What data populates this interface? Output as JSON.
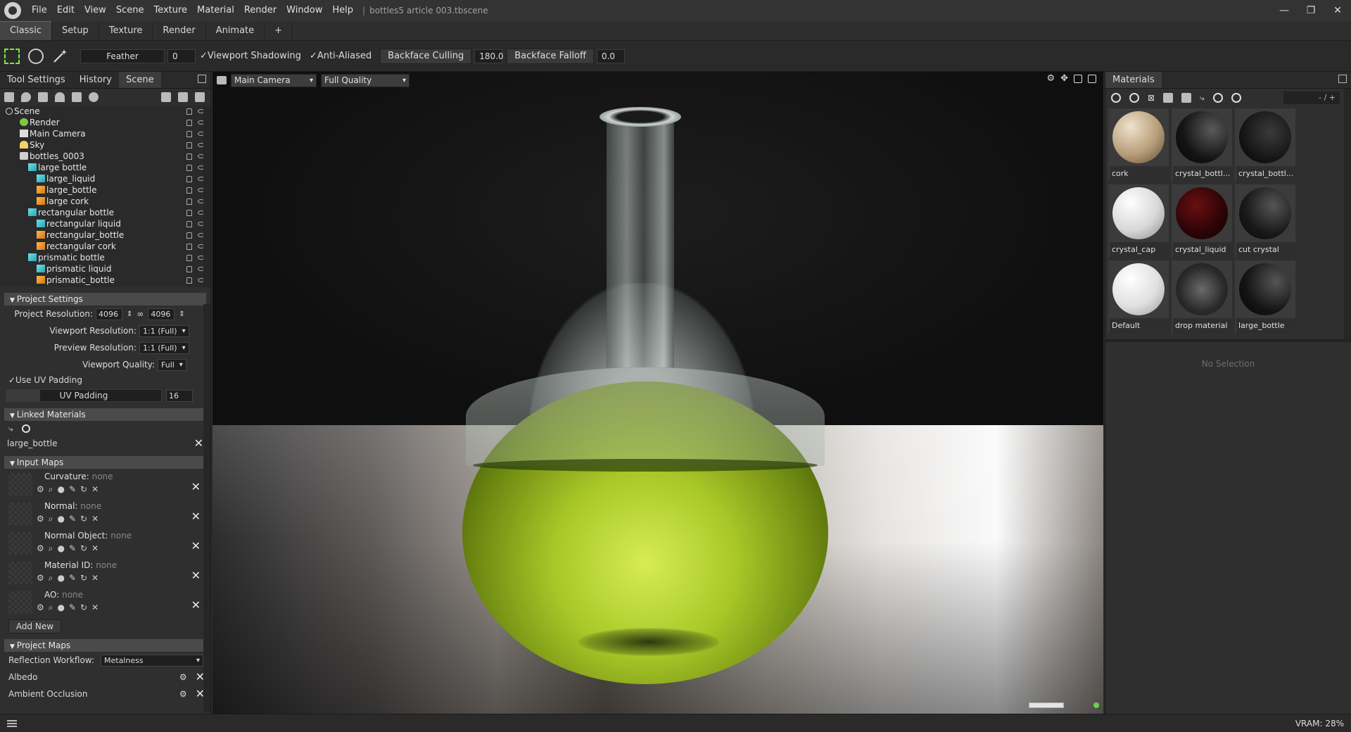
{
  "titlebar": {
    "menu": [
      "File",
      "Edit",
      "View",
      "Scene",
      "Texture",
      "Material",
      "Render",
      "Window",
      "Help"
    ],
    "separator": "|",
    "document_title": "bottles5 article 003.tbscene",
    "minimize": "—",
    "restore": "❐",
    "close": "✕"
  },
  "workspace_tabs": [
    "Classic",
    "Setup",
    "Texture",
    "Render",
    "Animate",
    "+"
  ],
  "toolbar": {
    "feather_label": "Feather",
    "feather_value": "0",
    "viewport_shadowing": "✓Viewport Shadowing",
    "anti_aliased": "✓Anti-Aliased",
    "backface_culling": "Backface Culling",
    "backface_culling_value": "180.0",
    "backface_falloff": "Backface Falloff",
    "backface_falloff_value": "0.0"
  },
  "left_tabs": [
    "Tool Settings",
    "History",
    "Scene"
  ],
  "scene_tree": [
    {
      "label": "Scene",
      "icon": "scene"
    },
    {
      "label": "Render",
      "icon": "render"
    },
    {
      "label": "Main Camera",
      "icon": "cam"
    },
    {
      "label": "Sky",
      "icon": "sky"
    },
    {
      "label": "bottles_0003",
      "icon": "folder"
    },
    {
      "label": "large bottle",
      "icon": "cube"
    },
    {
      "label": "large_liquid",
      "icon": "cube"
    },
    {
      "label": "large_bottle",
      "icon": "cube-orange"
    },
    {
      "label": "large cork",
      "icon": "cube-orange"
    },
    {
      "label": "rectangular bottle",
      "icon": "cube"
    },
    {
      "label": "rectangular liquid",
      "icon": "cube"
    },
    {
      "label": "rectangular_bottle",
      "icon": "cube-orange"
    },
    {
      "label": "rectangular cork",
      "icon": "cube-orange"
    },
    {
      "label": "prismatic bottle",
      "icon": "cube"
    },
    {
      "label": "prismatic liquid",
      "icon": "cube"
    },
    {
      "label": "prismatic_bottle",
      "icon": "cube-orange"
    }
  ],
  "project_settings": {
    "header": "Project Settings",
    "project_resolution_label": "Project Resolution:",
    "res_w": "4096",
    "res_h": "4096",
    "viewport_resolution_label": "Viewport Resolution:",
    "viewport_resolution": "1:1 (Full)",
    "preview_resolution_label": "Preview Resolution:",
    "preview_resolution": "1:1 (Full)",
    "viewport_quality_label": "Viewport Quality:",
    "viewport_quality": "Full",
    "use_uv_padding": "✓Use UV Padding",
    "uv_padding_label": "UV Padding",
    "uv_padding_value": "16"
  },
  "linked_materials": {
    "header": "Linked Materials",
    "item": "large_bottle"
  },
  "input_maps": {
    "header": "Input Maps",
    "maps": [
      {
        "name": "Curvature:",
        "value": "none"
      },
      {
        "name": "Normal:",
        "value": "none"
      },
      {
        "name": "Normal Object:",
        "value": "none"
      },
      {
        "name": "Material ID:",
        "value": "none"
      },
      {
        "name": "AO:",
        "value": "none"
      }
    ],
    "add_new": "Add New"
  },
  "project_maps": {
    "header": "Project Maps",
    "reflection_label": "Reflection Workflow:",
    "reflection_value": "Metalness",
    "items": [
      "Albedo",
      "Ambient Occlusion"
    ]
  },
  "viewport": {
    "camera": "Main Camera",
    "quality": "Full Quality"
  },
  "materials_panel": {
    "title": "Materials",
    "page": "- / +",
    "items": [
      {
        "label": "cork",
        "swatch": "cork"
      },
      {
        "label": "crystal_bottl...",
        "swatch": "dark-glass"
      },
      {
        "label": "crystal_bottl...",
        "swatch": "dark-sparkle"
      },
      {
        "label": "crystal_cap",
        "swatch": "white"
      },
      {
        "label": "crystal_liquid",
        "swatch": "dark-red"
      },
      {
        "label": "cut crystal",
        "swatch": "dark-sparkle"
      },
      {
        "label": "Default",
        "swatch": "white"
      },
      {
        "label": "drop material",
        "swatch": "droplets"
      },
      {
        "label": "large_bottle",
        "swatch": "dark-glass"
      }
    ],
    "no_selection": "No Selection"
  },
  "statusbar": {
    "vram": "VRAM: 28%"
  },
  "colors": {
    "accent_green": "#7ee64a",
    "panel_bg": "#2f2f2f",
    "header_bg": "#4a4a4a"
  }
}
